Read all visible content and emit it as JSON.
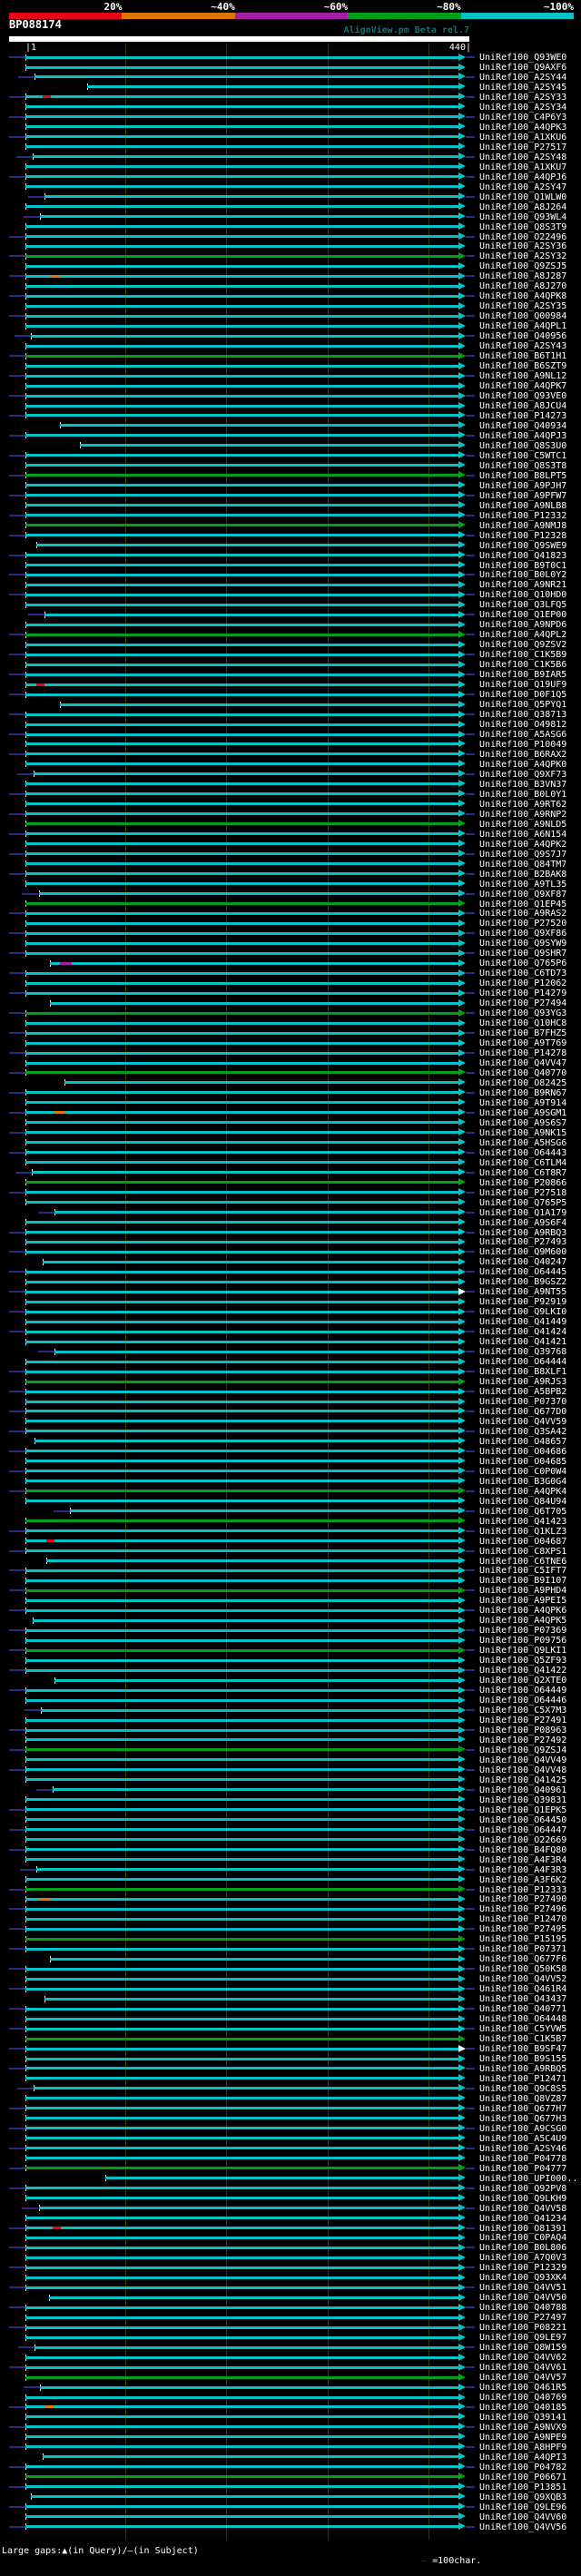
{
  "header": {
    "scale_labels": [
      "20%",
      "~40%",
      "~60%",
      "~80%",
      "~100%"
    ],
    "scale_colors": [
      "#ee0016",
      "#dd7700",
      "#a020a8",
      "#00a018",
      "#00c2c8"
    ],
    "query_title": "BP088174",
    "watermark": "AlignView.pm Beta rel.7",
    "ruler_start_label": "|1",
    "ruler_end_label": "440|"
  },
  "footer": {
    "legend_left": "Large gaps:▲(in Query)/—(in Subject)",
    "legend_dash": "—",
    "legend_right": " =100char."
  },
  "chart_data": {
    "type": "alignment-overview",
    "query_name": "BP088174",
    "query_length": 440,
    "x_axis": {
      "start": 1,
      "end": 440,
      "gridline_interval": 100
    },
    "legend_scale": "identity percent: red 20%, orange ~40%, purple ~60%, green ~80%, cyan ~100%",
    "colors": {
      "bar_cyan": "#00c2c8",
      "bar_green": "#00a018",
      "navy": "#2a2a84",
      "grid": "#373714",
      "tick": "#ffffff",
      "label": "#ffffff",
      "open_arrow": "#ffffff",
      "query_bar": "#ffffff",
      "watermark": "#007a7a"
    },
    "label_prefix": "UniRef100_",
    "rows_format": "[subject_id, color(0=cyan ~100%,1=green ~80%), align_start_residue, flags(1=navy lead,2=navy tail,4=open arrow)]",
    "rows": [
      [
        "Q93WE0",
        0,
        1,
        3
      ],
      [
        "Q9AXF6",
        0,
        1,
        0
      ],
      [
        "A2SY44",
        0,
        10,
        3
      ],
      [
        "A2SY45",
        0,
        62,
        0
      ],
      [
        "A2SY33",
        0,
        1,
        3
      ],
      [
        "A2SY34",
        0,
        1,
        0
      ],
      [
        "C4P6Y3",
        0,
        1,
        3
      ],
      [
        "A4QPK3",
        0,
        1,
        0
      ],
      [
        "A1XKU6",
        0,
        1,
        3
      ],
      [
        "P27517",
        0,
        1,
        0
      ],
      [
        "A2SY48",
        0,
        8,
        3
      ],
      [
        "A1XKU7",
        0,
        1,
        0
      ],
      [
        "A4QPJ6",
        0,
        1,
        3
      ],
      [
        "A2SY47",
        0,
        1,
        0
      ],
      [
        "Q1WLW0",
        0,
        20,
        3
      ],
      [
        "A8J264",
        0,
        1,
        0
      ],
      [
        "Q93WL4",
        0,
        15,
        3
      ],
      [
        "Q8S3T9",
        0,
        1,
        0
      ],
      [
        "O22496",
        0,
        1,
        3
      ],
      [
        "A2SY36",
        0,
        1,
        0
      ],
      [
        "A2SY32",
        1,
        1,
        3
      ],
      [
        "Q9ZSJ5",
        0,
        1,
        0
      ],
      [
        "A8J287",
        0,
        1,
        3
      ],
      [
        "A8J270",
        0,
        1,
        0
      ],
      [
        "A4QPK8",
        0,
        1,
        3
      ],
      [
        "A2SY35",
        0,
        1,
        0
      ],
      [
        "Q00984",
        0,
        1,
        3
      ],
      [
        "A4QPL1",
        0,
        1,
        0
      ],
      [
        "Q40956",
        0,
        6,
        3
      ],
      [
        "A2SY43",
        0,
        1,
        0
      ],
      [
        "B6T1H1",
        1,
        1,
        3
      ],
      [
        "B6SZT9",
        0,
        1,
        0
      ],
      [
        "A9NL12",
        0,
        1,
        3
      ],
      [
        "A4QPK7",
        0,
        1,
        0
      ],
      [
        "Q93VE0",
        0,
        1,
        3
      ],
      [
        "A8JCU4",
        0,
        1,
        0
      ],
      [
        "P14273",
        0,
        1,
        3
      ],
      [
        "Q40934",
        0,
        35,
        0
      ],
      [
        "A4QPJ3",
        0,
        1,
        3
      ],
      [
        "Q8S3U0",
        0,
        55,
        0
      ],
      [
        "C5WTC1",
        0,
        1,
        3
      ],
      [
        "Q8S3T8",
        0,
        1,
        0
      ],
      [
        "B8LPT5",
        1,
        1,
        3
      ],
      [
        "A9PJH7",
        0,
        1,
        0
      ],
      [
        "A9PFW7",
        0,
        1,
        3
      ],
      [
        "A9NLB8",
        0,
        1,
        0
      ],
      [
        "P12332",
        0,
        1,
        3
      ],
      [
        "A9NMJ8",
        1,
        1,
        0
      ],
      [
        "P12328",
        0,
        1,
        3
      ],
      [
        "Q9SWE9",
        0,
        12,
        0
      ],
      [
        "Q41823",
        0,
        1,
        3
      ],
      [
        "B9T0C1",
        0,
        1,
        0
      ],
      [
        "B0L0Y2",
        0,
        1,
        3
      ],
      [
        "A9NR21",
        0,
        1,
        0
      ],
      [
        "Q10HD0",
        0,
        1,
        3
      ],
      [
        "Q3LFQ5",
        0,
        1,
        0
      ],
      [
        "Q1EP00",
        0,
        20,
        3
      ],
      [
        "A9NPD6",
        0,
        1,
        0
      ],
      [
        "A4QPL2",
        1,
        1,
        3
      ],
      [
        "Q9ZSV2",
        0,
        1,
        0
      ],
      [
        "C1K5B9",
        0,
        1,
        3
      ],
      [
        "C1K5B6",
        0,
        1,
        0
      ],
      [
        "B9IAR5",
        0,
        1,
        3
      ],
      [
        "Q19UF9",
        0,
        1,
        0
      ],
      [
        "D0F1Q5",
        0,
        1,
        3
      ],
      [
        "Q5PYQ1",
        0,
        35,
        0
      ],
      [
        "Q38713",
        0,
        1,
        3
      ],
      [
        "O49812",
        0,
        1,
        0
      ],
      [
        "A5ASG6",
        0,
        1,
        3
      ],
      [
        "P10049",
        0,
        1,
        0
      ],
      [
        "B6RAX2",
        0,
        1,
        3
      ],
      [
        "A4QPK0",
        0,
        1,
        0
      ],
      [
        "Q9XF73",
        0,
        9,
        3
      ],
      [
        "B3VN37",
        0,
        1,
        0
      ],
      [
        "B0L0Y1",
        0,
        1,
        3
      ],
      [
        "A9RT62",
        0,
        1,
        0
      ],
      [
        "A9RNP2",
        0,
        1,
        3
      ],
      [
        "A9NLD5",
        1,
        1,
        0
      ],
      [
        "A6N154",
        0,
        1,
        3
      ],
      [
        "A4QPK2",
        0,
        1,
        0
      ],
      [
        "Q9S7J7",
        0,
        1,
        3
      ],
      [
        "Q84TM7",
        0,
        1,
        0
      ],
      [
        "B2BAK8",
        0,
        1,
        3
      ],
      [
        "A9TL35",
        0,
        1,
        0
      ],
      [
        "Q9XF87",
        0,
        14,
        3
      ],
      [
        "Q1EP45",
        1,
        1,
        0
      ],
      [
        "A9RAS2",
        0,
        1,
        3
      ],
      [
        "P27520",
        0,
        1,
        0
      ],
      [
        "Q9XF86",
        0,
        1,
        3
      ],
      [
        "Q9SYW9",
        0,
        1,
        0
      ],
      [
        "Q9SHR7",
        0,
        1,
        3
      ],
      [
        "Q765P6",
        0,
        25,
        0
      ],
      [
        "C6TD73",
        0,
        1,
        3
      ],
      [
        "P12062",
        0,
        1,
        0
      ],
      [
        "P14279",
        0,
        1,
        3
      ],
      [
        "P27494",
        0,
        25,
        0
      ],
      [
        "Q93YG3",
        1,
        1,
        3
      ],
      [
        "Q10HC8",
        0,
        1,
        0
      ],
      [
        "B7FHZ5",
        0,
        1,
        3
      ],
      [
        "A9T769",
        0,
        1,
        0
      ],
      [
        "P14278",
        0,
        1,
        3
      ],
      [
        "Q4VV47",
        0,
        1,
        0
      ],
      [
        "Q40770",
        1,
        1,
        3
      ],
      [
        "O82425",
        0,
        40,
        0
      ],
      [
        "B9RN67",
        0,
        1,
        3
      ],
      [
        "A9T914",
        0,
        1,
        0
      ],
      [
        "A9SGM1",
        0,
        1,
        3
      ],
      [
        "A9S6S7",
        0,
        1,
        0
      ],
      [
        "A9NK15",
        0,
        1,
        3
      ],
      [
        "A5HSG6",
        0,
        1,
        0
      ],
      [
        "O64443",
        0,
        1,
        3
      ],
      [
        "C6TLM4",
        0,
        1,
        0
      ],
      [
        "C6T8R7",
        0,
        7,
        3
      ],
      [
        "P20866",
        1,
        1,
        0
      ],
      [
        "P27518",
        0,
        1,
        3
      ],
      [
        "Q765P5",
        0,
        1,
        0
      ],
      [
        "Q1A179",
        0,
        30,
        3
      ],
      [
        "A9S6F4",
        0,
        1,
        0
      ],
      [
        "A9RBQ3",
        0,
        1,
        3
      ],
      [
        "P27493",
        0,
        1,
        0
      ],
      [
        "Q9M600",
        0,
        1,
        3
      ],
      [
        "Q40247",
        0,
        18,
        0
      ],
      [
        "O64445",
        0,
        1,
        3
      ],
      [
        "B9GSZ2",
        0,
        1,
        0
      ],
      [
        "A9NT55",
        0,
        1,
        7
      ],
      [
        "P92919",
        0,
        1,
        0
      ],
      [
        "Q9LKI0",
        0,
        1,
        3
      ],
      [
        "Q41449",
        0,
        1,
        0
      ],
      [
        "Q41424",
        0,
        1,
        3
      ],
      [
        "Q41421",
        0,
        1,
        0
      ],
      [
        "Q39768",
        0,
        30,
        3
      ],
      [
        "O64444",
        0,
        1,
        0
      ],
      [
        "B8XLF1",
        0,
        1,
        3
      ],
      [
        "A9RJS3",
        1,
        1,
        0
      ],
      [
        "A5BPB2",
        0,
        1,
        3
      ],
      [
        "P07370",
        0,
        1,
        0
      ],
      [
        "Q677D0",
        0,
        1,
        3
      ],
      [
        "Q4VV59",
        0,
        1,
        0
      ],
      [
        "Q3SA42",
        0,
        1,
        3
      ],
      [
        "O48657",
        0,
        10,
        0
      ],
      [
        "O04686",
        0,
        1,
        3
      ],
      [
        "O04685",
        0,
        1,
        0
      ],
      [
        "C0P0W4",
        0,
        1,
        3
      ],
      [
        "B3G0G4",
        0,
        1,
        0
      ],
      [
        "A4QPK4",
        1,
        1,
        3
      ],
      [
        "Q84U94",
        0,
        1,
        0
      ],
      [
        "Q6T705",
        0,
        45,
        3
      ],
      [
        "Q41423",
        1,
        1,
        0
      ],
      [
        "Q1KLZ3",
        0,
        1,
        3
      ],
      [
        "O04687",
        0,
        1,
        0
      ],
      [
        "C8XPS1",
        0,
        1,
        3
      ],
      [
        "C6TNE6",
        0,
        22,
        0
      ],
      [
        "C5IFT7",
        0,
        1,
        3
      ],
      [
        "B9I107",
        0,
        1,
        0
      ],
      [
        "A9PHD4",
        1,
        1,
        3
      ],
      [
        "A9PEI5",
        0,
        1,
        0
      ],
      [
        "A4QPK6",
        0,
        1,
        3
      ],
      [
        "A4QPK5",
        0,
        8,
        0
      ],
      [
        "P07369",
        0,
        1,
        3
      ],
      [
        "P09756",
        0,
        1,
        0
      ],
      [
        "Q9LKI1",
        1,
        1,
        3
      ],
      [
        "Q5ZF93",
        0,
        1,
        0
      ],
      [
        "Q41422",
        0,
        1,
        3
      ],
      [
        "Q2XTE0",
        0,
        30,
        0
      ],
      [
        "O64449",
        0,
        1,
        3
      ],
      [
        "O64446",
        0,
        1,
        0
      ],
      [
        "C5X7M3",
        0,
        16,
        3
      ],
      [
        "P27491",
        0,
        1,
        0
      ],
      [
        "P08963",
        0,
        1,
        3
      ],
      [
        "P27492",
        0,
        1,
        0
      ],
      [
        "Q9ZSJ4",
        1,
        1,
        3
      ],
      [
        "Q4VV49",
        0,
        1,
        0
      ],
      [
        "Q4VV48",
        0,
        1,
        3
      ],
      [
        "Q41425",
        0,
        1,
        0
      ],
      [
        "Q40961",
        0,
        28,
        3
      ],
      [
        "Q39831",
        0,
        1,
        0
      ],
      [
        "Q1EPK5",
        0,
        1,
        3
      ],
      [
        "O64450",
        0,
        1,
        0
      ],
      [
        "O64447",
        0,
        1,
        3
      ],
      [
        "O22669",
        0,
        1,
        0
      ],
      [
        "B4FQ80",
        0,
        1,
        3
      ],
      [
        "A4F3R4",
        0,
        1,
        0
      ],
      [
        "A4F3R3",
        0,
        12,
        3
      ],
      [
        "A3F6K2",
        0,
        1,
        0
      ],
      [
        "P12333",
        1,
        1,
        3
      ],
      [
        "P27490",
        0,
        1,
        0
      ],
      [
        "P27496",
        0,
        1,
        3
      ],
      [
        "P12470",
        0,
        1,
        0
      ],
      [
        "P27495",
        0,
        1,
        3
      ],
      [
        "P15195",
        1,
        1,
        0
      ],
      [
        "P07371",
        0,
        1,
        3
      ],
      [
        "Q677F6",
        0,
        25,
        0
      ],
      [
        "Q50K58",
        0,
        1,
        3
      ],
      [
        "Q4VV52",
        0,
        1,
        0
      ],
      [
        "Q461R4",
        0,
        1,
        3
      ],
      [
        "Q43437",
        0,
        20,
        0
      ],
      [
        "Q40771",
        0,
        1,
        3
      ],
      [
        "O64448",
        0,
        1,
        0
      ],
      [
        "C5YVW5",
        0,
        1,
        3
      ],
      [
        "C1K5B7",
        1,
        1,
        0
      ],
      [
        "B9SF47",
        0,
        1,
        7
      ],
      [
        "B9S155",
        0,
        1,
        0
      ],
      [
        "A9RBQ5",
        0,
        1,
        3
      ],
      [
        "P12471",
        0,
        1,
        0
      ],
      [
        "Q9C8S5",
        0,
        9,
        3
      ],
      [
        "Q8VZ87",
        0,
        1,
        0
      ],
      [
        "Q677H7",
        0,
        1,
        3
      ],
      [
        "Q677H3",
        0,
        1,
        0
      ],
      [
        "A9CSG0",
        0,
        1,
        3
      ],
      [
        "A5C4U9",
        0,
        1,
        0
      ],
      [
        "A2SY46",
        0,
        1,
        3
      ],
      [
        "P04778",
        0,
        1,
        0
      ],
      [
        "P04777",
        1,
        1,
        3
      ],
      [
        "UPI000..",
        0,
        80,
        0
      ],
      [
        "Q92PV8",
        0,
        1,
        3
      ],
      [
        "Q9LKH9",
        0,
        1,
        0
      ],
      [
        "Q4VV58",
        0,
        14,
        3
      ],
      [
        "Q41234",
        0,
        1,
        0
      ],
      [
        "O81391",
        0,
        1,
        3
      ],
      [
        "C0PAQ4",
        0,
        1,
        0
      ],
      [
        "B0L806",
        0,
        1,
        3
      ],
      [
        "A7Q0V3",
        0,
        1,
        0
      ],
      [
        "P12329",
        0,
        1,
        3
      ],
      [
        "Q93XK4",
        0,
        1,
        0
      ],
      [
        "Q4VV51",
        0,
        1,
        3
      ],
      [
        "Q4VV50",
        0,
        24,
        0
      ],
      [
        "Q40788",
        0,
        1,
        3
      ],
      [
        "P27497",
        0,
        1,
        0
      ],
      [
        "P08221",
        0,
        1,
        3
      ],
      [
        "Q9LE97",
        0,
        1,
        0
      ],
      [
        "Q8W159",
        0,
        10,
        3
      ],
      [
        "Q4VV62",
        0,
        1,
        0
      ],
      [
        "Q4VV61",
        0,
        1,
        3
      ],
      [
        "Q4VV57",
        1,
        1,
        0
      ],
      [
        "Q461R5",
        0,
        15,
        3
      ],
      [
        "Q40769",
        0,
        1,
        0
      ],
      [
        "Q40185",
        0,
        1,
        3
      ],
      [
        "Q39141",
        0,
        1,
        0
      ],
      [
        "A9NVX9",
        0,
        1,
        3
      ],
      [
        "A9NPE9",
        0,
        1,
        0
      ],
      [
        "A8HPF9",
        0,
        1,
        3
      ],
      [
        "A4QPI3",
        0,
        18,
        0
      ],
      [
        "P04782",
        0,
        1,
        3
      ],
      [
        "P06671",
        1,
        1,
        0
      ],
      [
        "P13851",
        0,
        1,
        3
      ],
      [
        "Q9XQB3",
        0,
        6,
        0
      ],
      [
        "Q9LE96",
        0,
        1,
        3
      ],
      [
        "Q4VV60",
        0,
        1,
        0
      ],
      [
        "Q4VV56",
        0,
        1,
        3
      ]
    ],
    "marks_format": "[row_index0,pos_residue,width_residues,color]",
    "marks": [
      [
        4,
        18,
        8,
        "#ee0016"
      ],
      [
        22,
        25,
        10,
        "#dd7700"
      ],
      [
        63,
        12,
        8,
        "#ee0016"
      ],
      [
        91,
        35,
        12,
        "#a020a8"
      ],
      [
        106,
        30,
        10,
        "#dd7700"
      ],
      [
        149,
        22,
        8,
        "#ee0016"
      ],
      [
        185,
        15,
        10,
        "#dd7700"
      ],
      [
        218,
        28,
        8,
        "#ee0016"
      ],
      [
        236,
        20,
        10,
        "#dd7700"
      ]
    ]
  }
}
